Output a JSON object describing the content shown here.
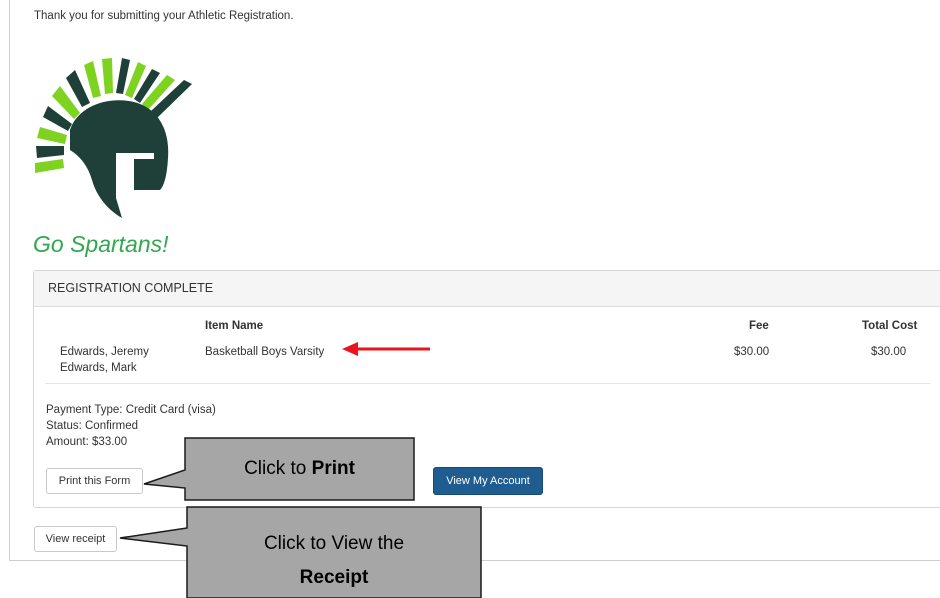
{
  "confirmation_message": "Thank you for submitting your Athletic Registration.",
  "tagline": "Go Spartans!",
  "panel": {
    "heading": "REGISTRATION COMPLETE",
    "columns": {
      "item_name": "Item Name",
      "fee": "Fee",
      "total_cost": "Total Cost"
    },
    "row": {
      "athletes": [
        "Edwards, Jeremy",
        "Edwards, Mark"
      ],
      "item_name": "Basketball Boys Varsity",
      "fee": "$30.00",
      "total_cost": "$30.00"
    },
    "payment": {
      "type": "Payment Type: Credit Card (visa)",
      "status": "Status: Confirmed",
      "amount": "Amount: $33.00"
    },
    "print_button": "Print this Form",
    "account_button": "View My Account"
  },
  "receipt_button": "View receipt",
  "callouts": {
    "print": {
      "prefix": "Click to ",
      "bold": "Print"
    },
    "receipt": {
      "line1": "Click to View the",
      "bold": "Receipt"
    }
  },
  "colors": {
    "logo_dark": "#1e4038",
    "logo_green": "#7ed321",
    "tagline": "#2fa84f",
    "primary_button": "#1f5c8f",
    "callout_fill": "#a6a6a6",
    "arrow": "#e8161b"
  },
  "icons": {
    "logo": "spartan-helmet-logo",
    "arrow": "red-arrow-pointer"
  }
}
